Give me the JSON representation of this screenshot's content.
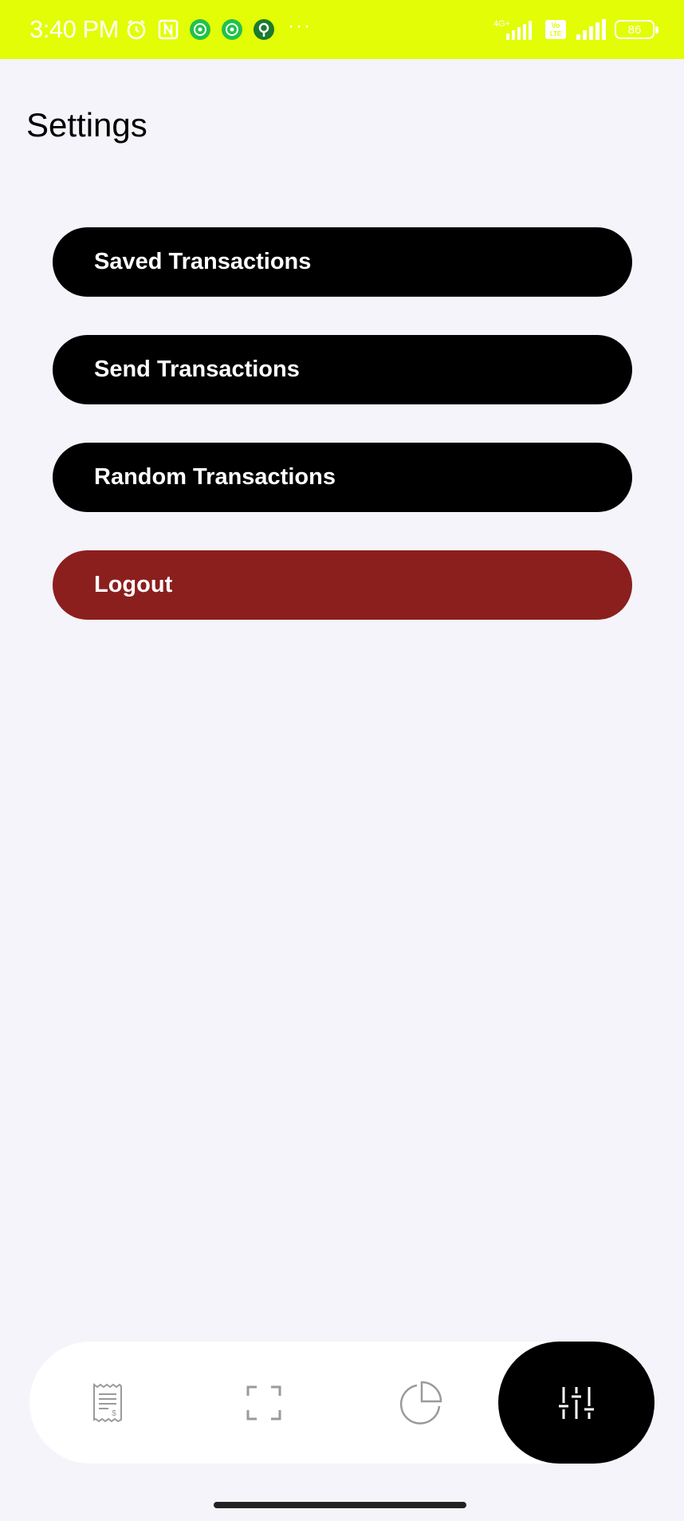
{
  "status_bar": {
    "time": "3:40 PM",
    "network_label": "4G+",
    "volte_label": "Vo LTE",
    "battery_level": "86",
    "background_color": "#e2fd05",
    "icons": [
      "alarm-icon",
      "nfc-icon",
      "whatsapp-icon",
      "whatsapp-icon",
      "location-icon",
      "more-dots-icon",
      "signal-icon",
      "signal-icon",
      "battery-icon"
    ],
    "more_dots": "···"
  },
  "page": {
    "title": "Settings"
  },
  "menu": {
    "items": [
      {
        "label": "Saved Transactions",
        "color": "#000000"
      },
      {
        "label": "Send Transactions",
        "color": "#000000"
      },
      {
        "label": "Random Transactions",
        "color": "#000000"
      },
      {
        "label": "Logout",
        "color": "#8b1f1e"
      }
    ]
  },
  "bottom_nav": {
    "items": [
      {
        "icon": "receipt-icon",
        "active": false
      },
      {
        "icon": "scan-frame-icon",
        "active": false
      },
      {
        "icon": "pie-chart-icon",
        "active": false
      },
      {
        "icon": "sliders-icon",
        "active": true
      }
    ]
  }
}
